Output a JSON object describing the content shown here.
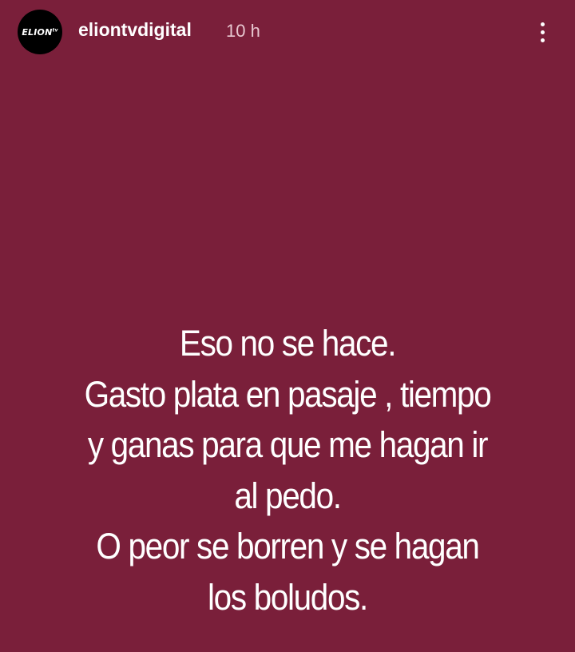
{
  "header": {
    "avatar_text": "ELION",
    "avatar_sup": "tv",
    "username": "eliontvdigital",
    "timestamp": "10 h",
    "menu_icon": "more-vertical-icon"
  },
  "story": {
    "background_color": "#7a1f3a",
    "lines": [
      "Eso no se hace.",
      "Gasto plata en pasaje , tiempo",
      "y ganas para que me hagan ir",
      "al pedo.",
      "O peor se borren y se hagan",
      "los boludos."
    ]
  }
}
